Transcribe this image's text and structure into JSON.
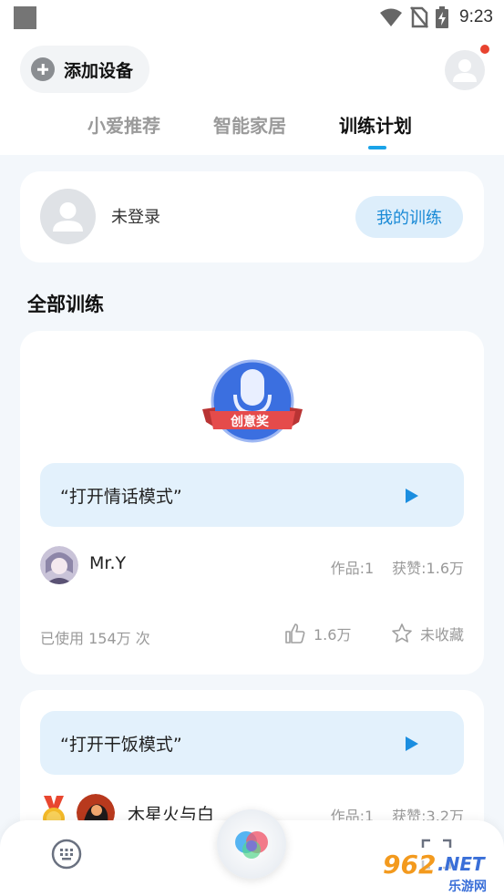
{
  "status_bar": {
    "time": "9:23"
  },
  "header": {
    "add_device_label": "添加设备"
  },
  "tabs": [
    {
      "label": "小爱推荐",
      "active": false
    },
    {
      "label": "智能家居",
      "active": false
    },
    {
      "label": "训练计划",
      "active": true
    }
  ],
  "user_card": {
    "status": "未登录",
    "my_training_label": "我的训练"
  },
  "section_title": "全部训练",
  "training_cards": [
    {
      "badge_label": "创意奖",
      "phrase": "“打开情话模式”",
      "author": "Mr.Y",
      "works": "作品:1",
      "likes_received": "获赞:1.6万",
      "usage": "已使用 154万 次",
      "likes": "1.6万",
      "favorite": "未收藏"
    },
    {
      "phrase": "“打开干饭模式”",
      "author": "木星火与白",
      "works": "作品:1",
      "likes_received": "获赞:3.2万"
    }
  ],
  "watermark": {
    "brand": "962",
    "suffix": ".NET",
    "sub": "乐游网"
  },
  "colors": {
    "accent": "#1aa3e8",
    "phrase_bg": "#e3f1fc",
    "badge_blue": "#3b6fe0",
    "badge_ribbon": "#e54b4b"
  }
}
